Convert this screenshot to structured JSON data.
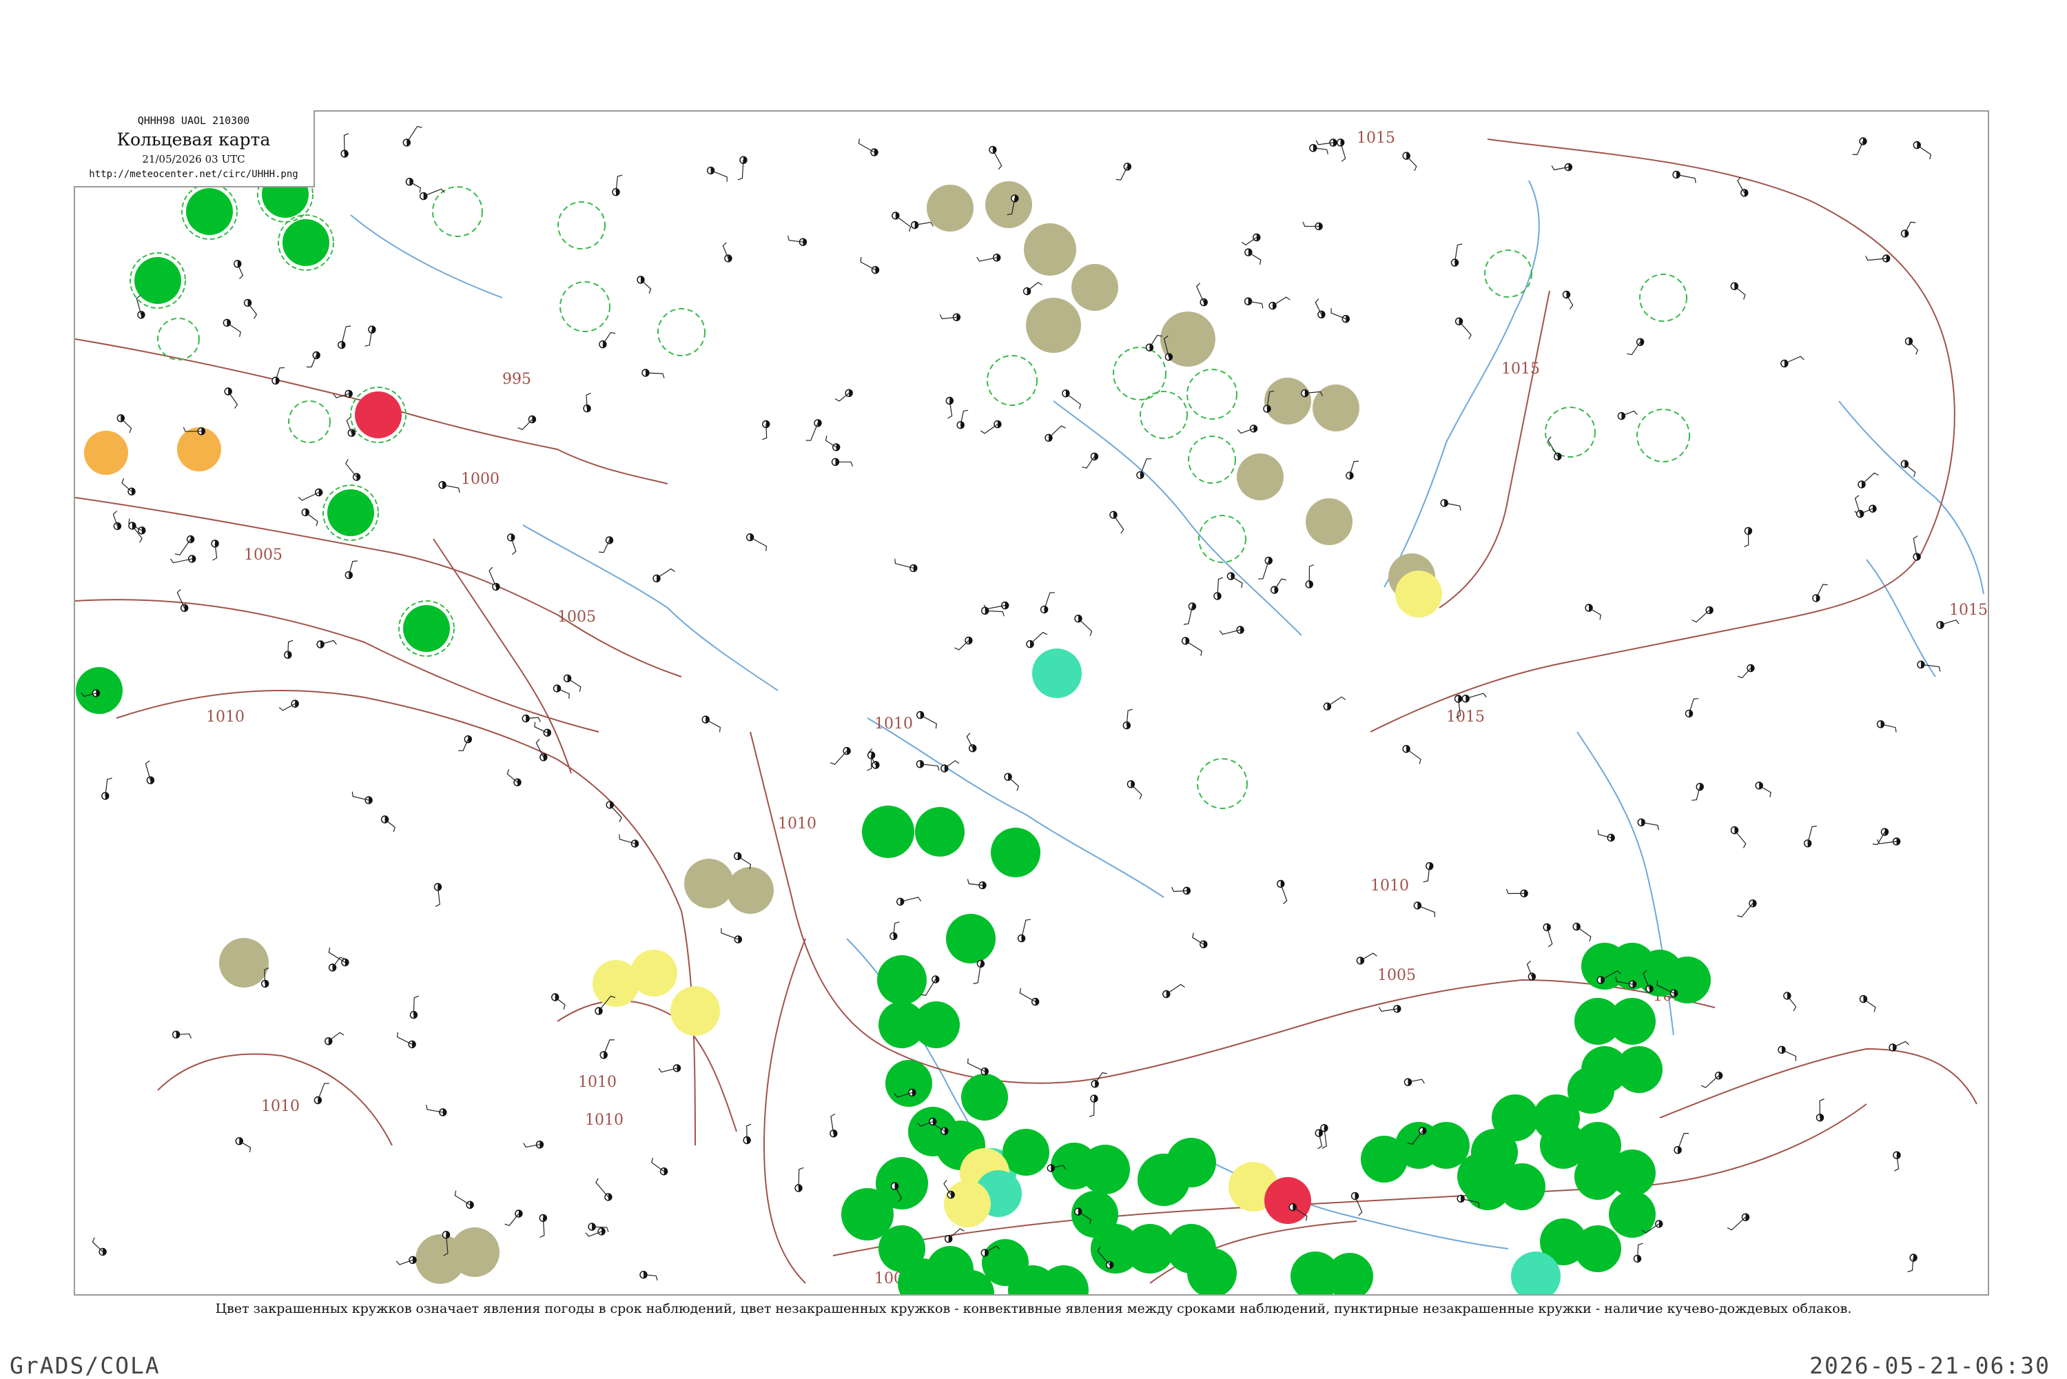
{
  "header": {
    "code": "QHHH98  UAOL  210300",
    "title": "Кольцевая карта",
    "time": "21/05/2026 03 UTC",
    "url": "http://meteocenter.net/circ/UHHH.png"
  },
  "isobar_labels": [
    "995",
    "1000",
    "1005",
    "1010",
    "1015"
  ],
  "footer": {
    "caption": "Цвет закрашенных кружков означает явления погоды в срок наблюдений, цвет незакрашенных кружков - конвективные явления между сроками наблюдений, пунктирные незакрашенные кружки - наличие кучево-дождевых облаков.",
    "brand": "GrADS/COLA",
    "timestamp": "2026-05-21-06:30"
  },
  "colors": {
    "isobar": "#a0524a",
    "water": "#6fa8d8",
    "rain": "#00bf2a",
    "fog": "#b8b48a",
    "snow": "#f5f07a",
    "thunder": "#e8304a",
    "drizzle": "#f5b248",
    "showers": "#40e0b0",
    "cb_ring": "#38b848",
    "frame": "#9a9a9a"
  },
  "legend_colors_semantics": [
    "rain-circle",
    "fog-circle",
    "snow-circle",
    "thunder-circle",
    "drizzle-circle",
    "cb-dashed-ring"
  ]
}
